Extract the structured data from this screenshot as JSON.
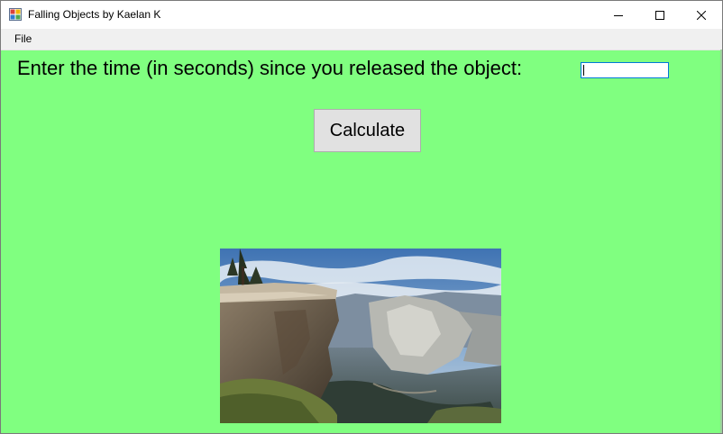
{
  "window": {
    "title": "Falling Objects by Kaelan K",
    "background_color": "#80ff80",
    "controls": [
      "minimize-icon",
      "maximize-icon",
      "close-icon"
    ]
  },
  "menu": {
    "items": [
      {
        "label": "File"
      }
    ]
  },
  "form": {
    "prompt": "Enter the time (in seconds) since you released the object:",
    "time_input_value": "",
    "calculate_label": "Calculate"
  },
  "picture": {
    "icon": "cliff-landscape-photo"
  }
}
